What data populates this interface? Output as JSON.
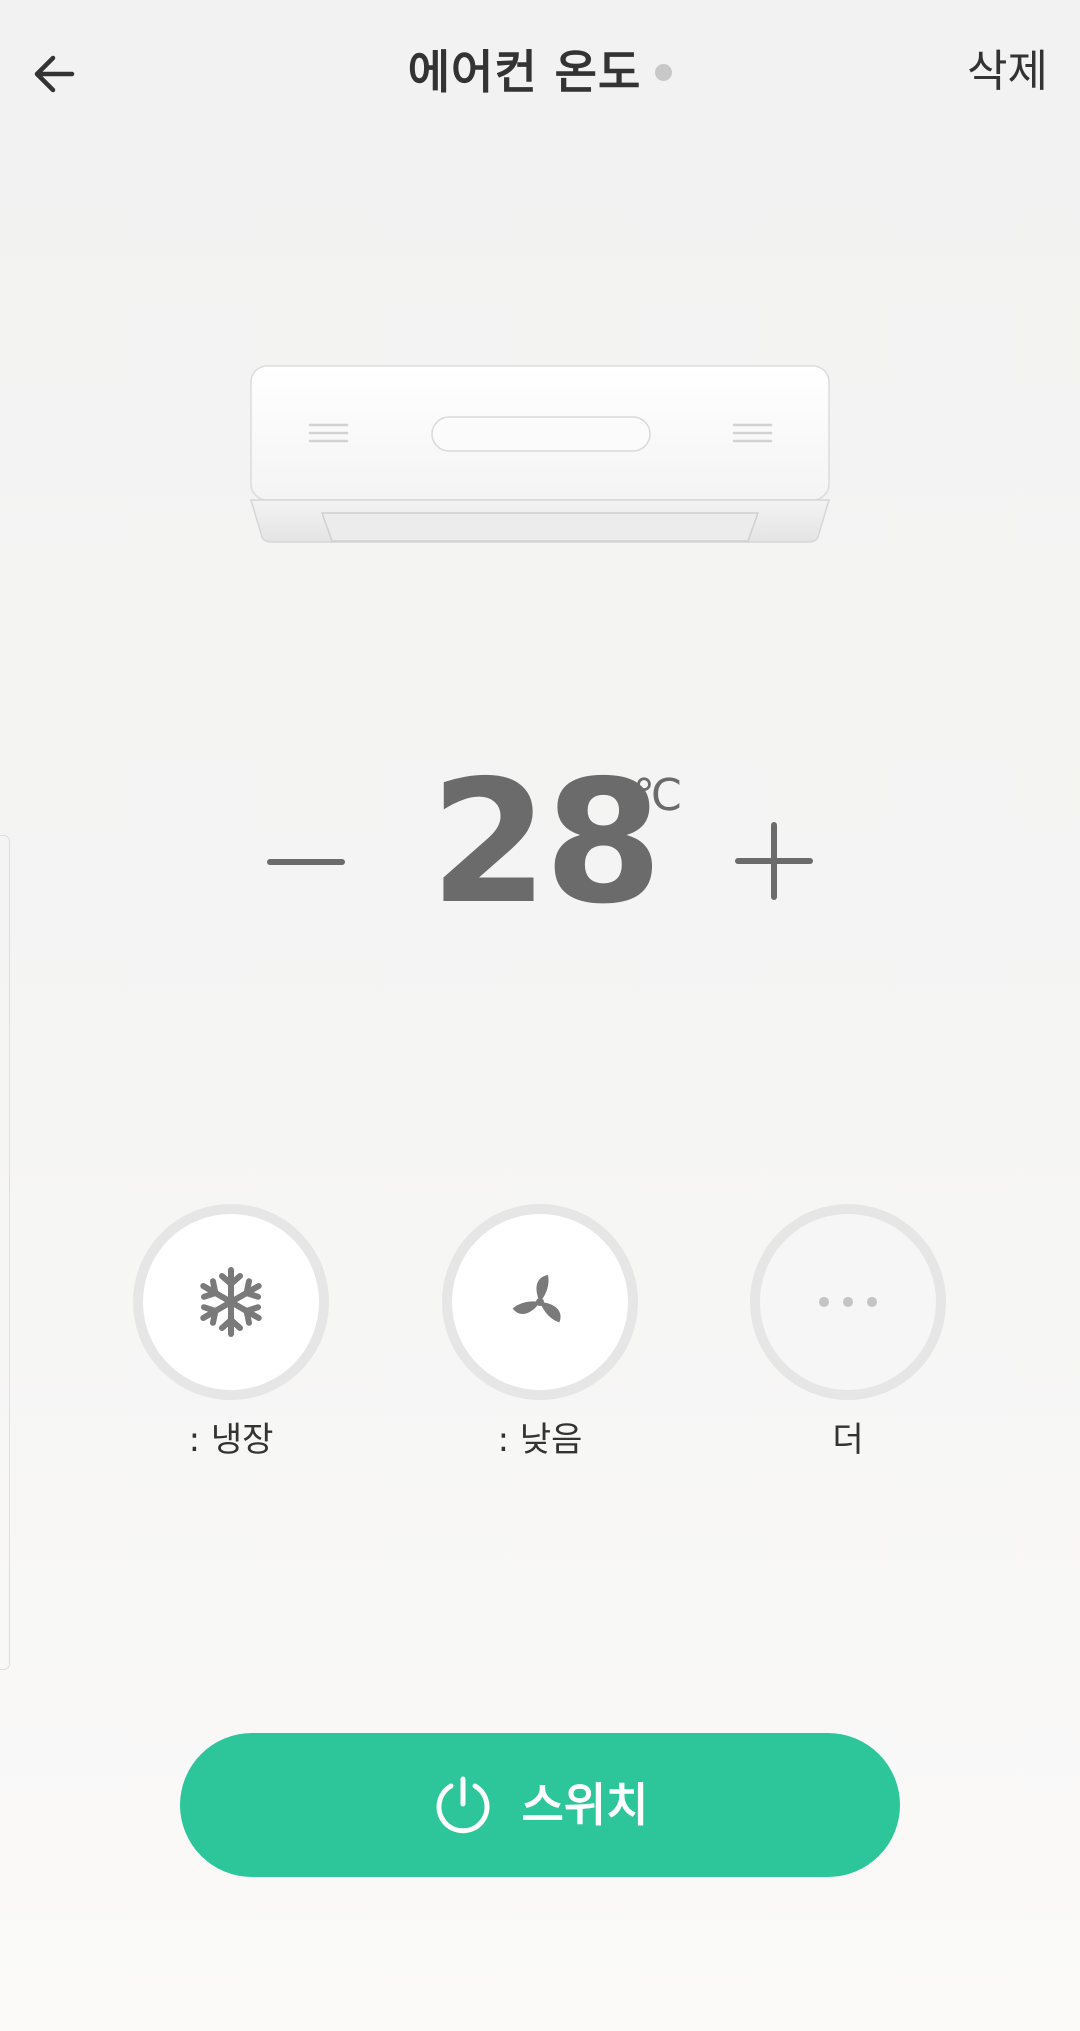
{
  "header": {
    "title": "에어컨 온도",
    "delete_label": "삭제"
  },
  "temperature": {
    "value": "28",
    "unit": "℃"
  },
  "modes": [
    {
      "label": ": 냉장",
      "icon": "snowflake-icon"
    },
    {
      "label": ": 낮음",
      "icon": "fan-icon"
    },
    {
      "label": "더",
      "icon": "more-dots-icon"
    }
  ],
  "switch": {
    "label": "스위치",
    "icon": "power-icon"
  },
  "colors": {
    "accent": "#2cc69a",
    "temperature_text": "#6b6b6b",
    "status_dot": "#c8c8c8"
  }
}
